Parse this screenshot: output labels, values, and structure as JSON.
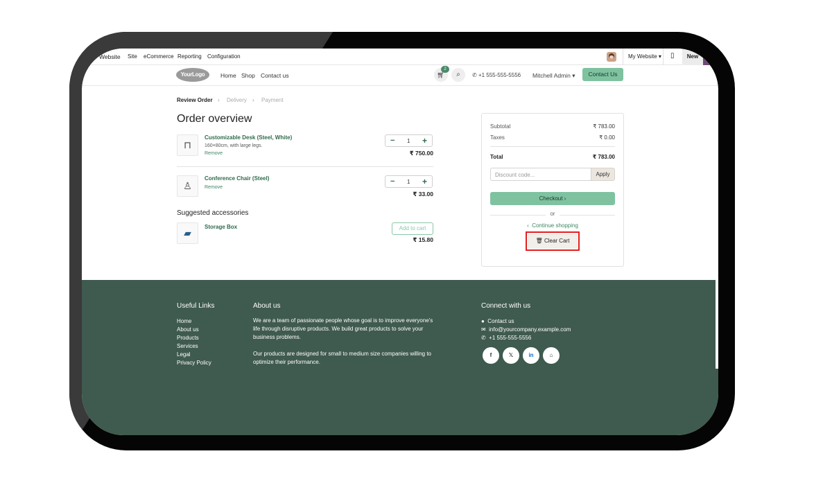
{
  "admin_bar": {
    "items": [
      "Website",
      "Site",
      "eCommerce",
      "Reporting",
      "Configuration"
    ],
    "website_selector": "My Website",
    "new_label": "New"
  },
  "header": {
    "logo_text": "YourLogo",
    "nav": [
      "Home",
      "Shop",
      "Contact us"
    ],
    "cart_count": "2",
    "phone": "+1 555-555-5556",
    "user_name": "Mitchell Admin",
    "contact_button": "Contact Us"
  },
  "breadcrumb": {
    "steps": [
      "Review Order",
      "Delivery",
      "Payment"
    ]
  },
  "order": {
    "title": "Order overview",
    "lines": [
      {
        "name": "Customizable Desk (Steel, White)",
        "description": "160×80cm, with large legs.",
        "remove_label": "Remove",
        "quantity": "1",
        "price": "₹ 750.00",
        "icon": "desk-icon"
      },
      {
        "name": "Conference Chair (Steel)",
        "description": "",
        "remove_label": "Remove",
        "quantity": "1",
        "price": "₹ 33.00",
        "icon": "chair-icon"
      }
    ]
  },
  "suggested": {
    "title": "Suggested accessories",
    "items": [
      {
        "name": "Storage Box",
        "add_label": "Add to cart",
        "price": "₹ 15.80",
        "icon": "storage-box-icon"
      }
    ]
  },
  "summary": {
    "subtotal_label": "Subtotal",
    "subtotal": "₹ 783.00",
    "taxes_label": "Taxes",
    "taxes": "₹ 0.00",
    "total_label": "Total",
    "total": "₹ 783.00",
    "discount_placeholder": "Discount code...",
    "apply_label": "Apply",
    "checkout_label": "Checkout",
    "or_label": "or",
    "continue_label": "Continue shopping",
    "clear_label": "Clear Cart"
  },
  "footer": {
    "useful_links_title": "Useful Links",
    "useful_links": [
      "Home",
      "About us",
      "Products",
      "Services",
      "Legal",
      "Privacy Policy"
    ],
    "about_title": "About us",
    "about_p1": "We are a team of passionate people whose goal is to improve everyone's life through disruptive products. We build great products to solve your business problems.",
    "about_p2": "Our products are designed for small to medium size companies willing to optimize their performance.",
    "connect_title": "Connect with us",
    "contact_link": "Contact us",
    "email": "info@yourcompany.example.com",
    "phone": "+1 555-555-5556",
    "social": [
      "facebook-icon",
      "x-icon",
      "linkedin-icon",
      "home-icon"
    ]
  },
  "colors": {
    "brand_green": "#7fc2a0",
    "footer_bg": "#3f5a4e",
    "link_green": "#2f6a4c",
    "highlight_red": "#e31d1d"
  }
}
